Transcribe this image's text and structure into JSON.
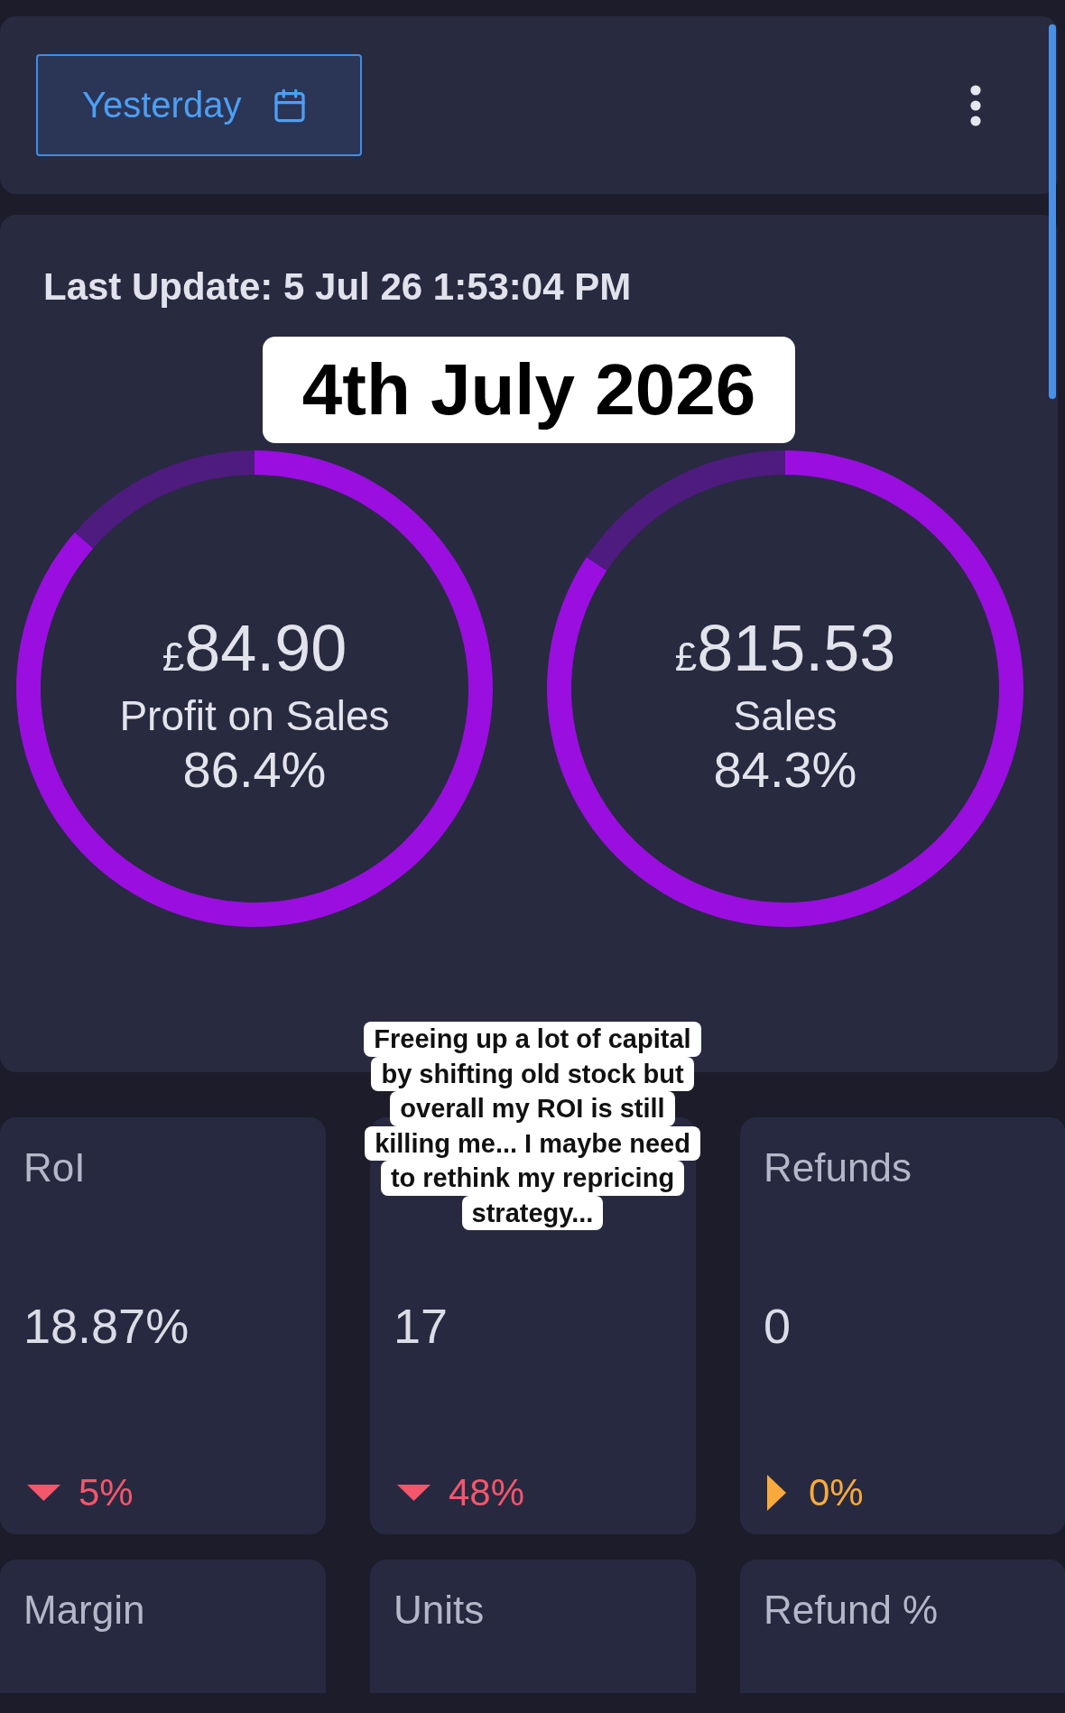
{
  "toolbar": {
    "date_button": "Yesterday"
  },
  "summary": {
    "last_update": "Last Update: 5 Jul 26 1:53:04 PM",
    "date_caption": "4th July 2026",
    "gauges": [
      {
        "currency": "£",
        "amount": "84.90",
        "label": "Profit on Sales",
        "percent": "86.4%",
        "chart_data": {
          "type": "donut",
          "values": [
            86.4,
            13.6
          ]
        }
      },
      {
        "currency": "£",
        "amount": "815.53",
        "label": "Sales",
        "percent": "84.3%",
        "chart_data": {
          "type": "donut",
          "values": [
            84.3,
            15.7
          ]
        }
      }
    ]
  },
  "caption_overlay": {
    "lines": [
      "Freeing up a lot of capital",
      "by shifting old stock but",
      "overall my ROI is still",
      "killing me... I maybe need",
      "to rethink my repricing",
      "strategy..."
    ]
  },
  "metrics": [
    {
      "label": "RoI",
      "value": "18.87%",
      "change": {
        "kind": "down",
        "text": "5%"
      }
    },
    {
      "value": "17",
      "change": {
        "kind": "down",
        "text": "48%"
      }
    },
    {
      "label": "Refunds",
      "value": "0",
      "change": {
        "kind": "flat",
        "text": "0%"
      }
    },
    {
      "label": "Margin"
    },
    {
      "label": "Units"
    },
    {
      "label": "Refund %"
    }
  ]
}
